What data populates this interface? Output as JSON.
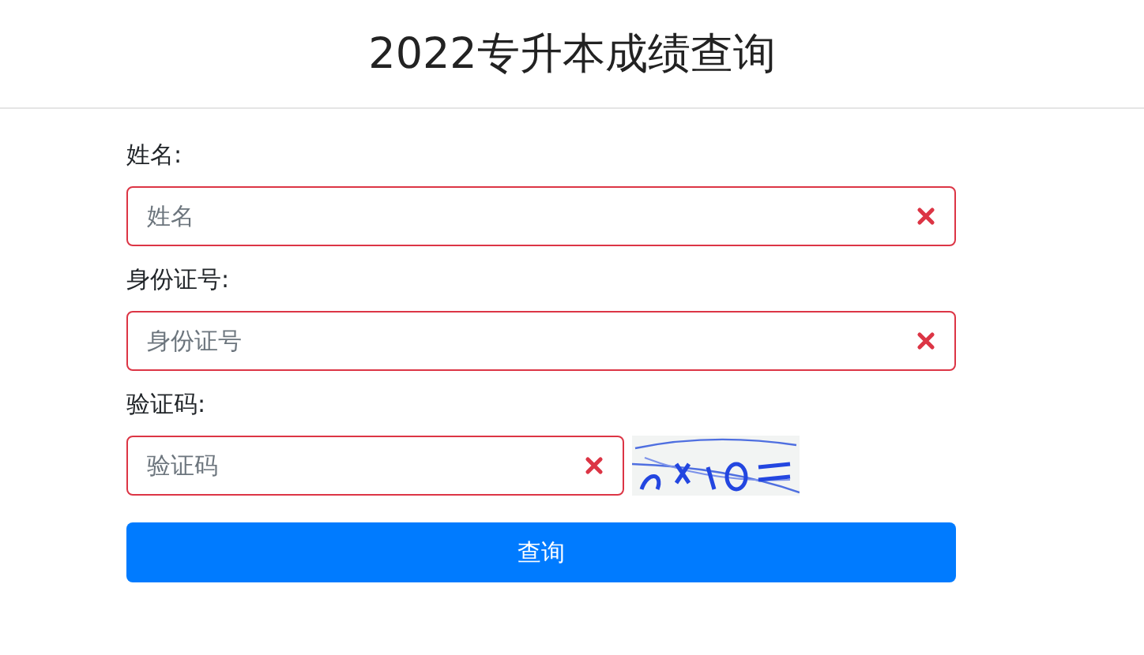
{
  "header": {
    "title": "2022专升本成绩查询"
  },
  "fields": [
    {
      "kind": "text",
      "label": "姓名:",
      "placeholder": "姓名",
      "invalid": true
    },
    {
      "kind": "text",
      "label": "身份证号:",
      "placeholder": "身份证号",
      "invalid": true
    },
    {
      "kind": "captcha",
      "label": "验证码:",
      "placeholder": "验证码",
      "invalid": true
    }
  ],
  "submit": {
    "label": "查询"
  }
}
